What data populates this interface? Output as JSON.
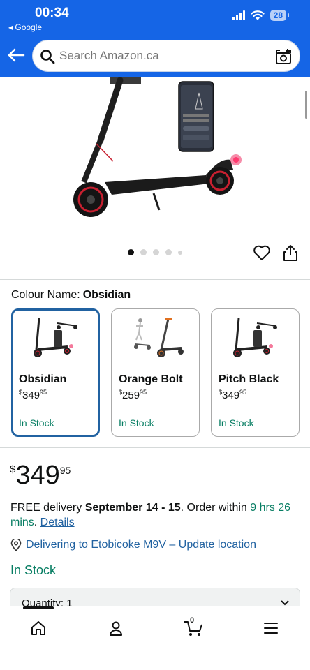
{
  "status_bar": {
    "time": "00:34",
    "back_app": "◂ Google",
    "battery": "28"
  },
  "search": {
    "placeholder": "Search Amazon.ca"
  },
  "gallery": {
    "dot_count": 5,
    "active_index": 0
  },
  "colour": {
    "label": "Colour Name:",
    "selected": "Obsidian"
  },
  "variants": [
    {
      "name": "Obsidian",
      "currency": "$",
      "whole": "349",
      "fraction": "95",
      "stock": "In Stock",
      "selected": true
    },
    {
      "name": "Orange Bolt",
      "currency": "$",
      "whole": "259",
      "fraction": "95",
      "stock": "In Stock",
      "selected": false
    },
    {
      "name": "Pitch Black",
      "currency": "$",
      "whole": "349",
      "fraction": "95",
      "stock": "In Stock",
      "selected": false
    }
  ],
  "price": {
    "currency": "$",
    "whole": "349",
    "fraction": "95"
  },
  "delivery": {
    "prefix": "FREE delivery ",
    "dates": "September 14 - 15",
    "mid": ". Order within ",
    "time_left": "9 hrs 26 mins",
    "sep": ". ",
    "details_link": "Details"
  },
  "deliver_to": {
    "text": "Delivering to Etobicoke M9V – Update location"
  },
  "stock_status": "In Stock",
  "quantity": {
    "label": "Quantity: 1"
  },
  "cart": {
    "count": "0"
  },
  "colors": {
    "brand_blue": "#1565e6",
    "link": "#2162a1",
    "in_stock": "#067d62",
    "selected_border": "#2162a1"
  }
}
